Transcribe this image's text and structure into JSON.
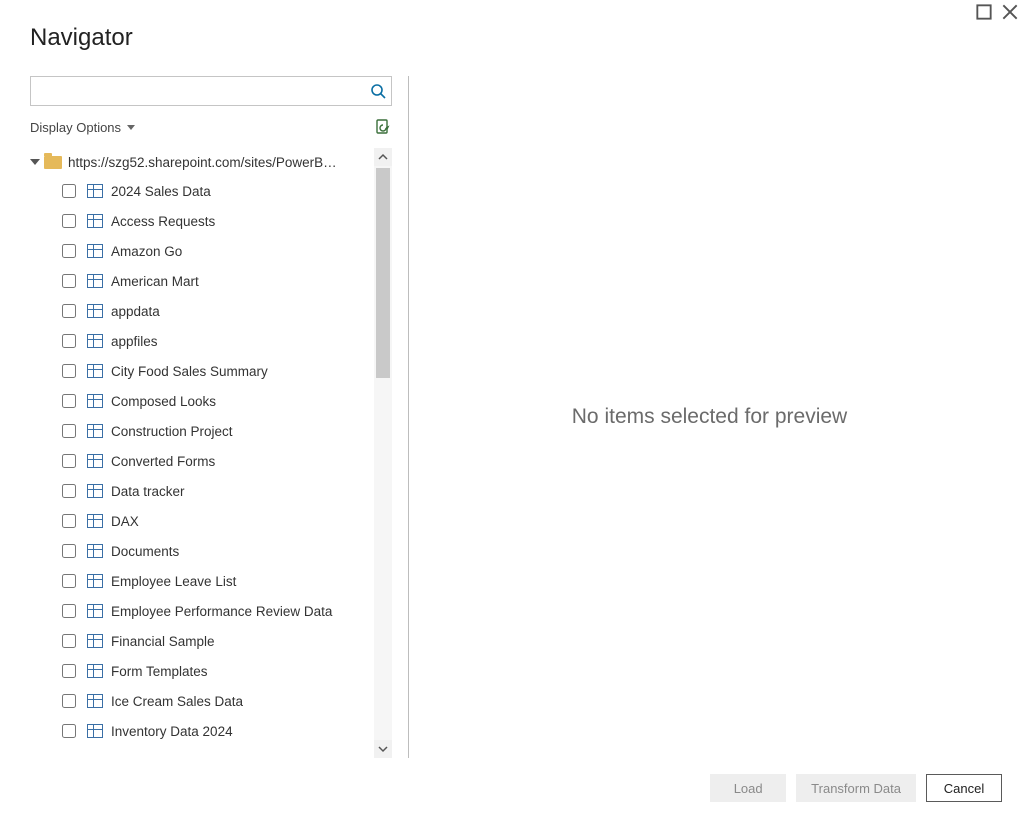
{
  "title": "Navigator",
  "search": {
    "placeholder": ""
  },
  "options": {
    "displayOptions": "Display Options"
  },
  "tree": {
    "rootLabel": "https://szg52.sharepoint.com/sites/PowerBI...",
    "items": [
      {
        "label": "2024 Sales Data"
      },
      {
        "label": "Access Requests"
      },
      {
        "label": "Amazon Go"
      },
      {
        "label": "American Mart"
      },
      {
        "label": "appdata"
      },
      {
        "label": "appfiles"
      },
      {
        "label": "City Food Sales Summary"
      },
      {
        "label": "Composed Looks"
      },
      {
        "label": "Construction Project"
      },
      {
        "label": "Converted Forms"
      },
      {
        "label": "Data tracker"
      },
      {
        "label": "DAX"
      },
      {
        "label": "Documents"
      },
      {
        "label": "Employee Leave List"
      },
      {
        "label": "Employee Performance Review Data"
      },
      {
        "label": "Financial Sample"
      },
      {
        "label": "Form Templates"
      },
      {
        "label": "Ice Cream Sales Data"
      },
      {
        "label": "Inventory Data 2024"
      }
    ]
  },
  "preview": {
    "message": "No items selected for preview"
  },
  "footer": {
    "load": "Load",
    "transform": "Transform Data",
    "cancel": "Cancel"
  }
}
